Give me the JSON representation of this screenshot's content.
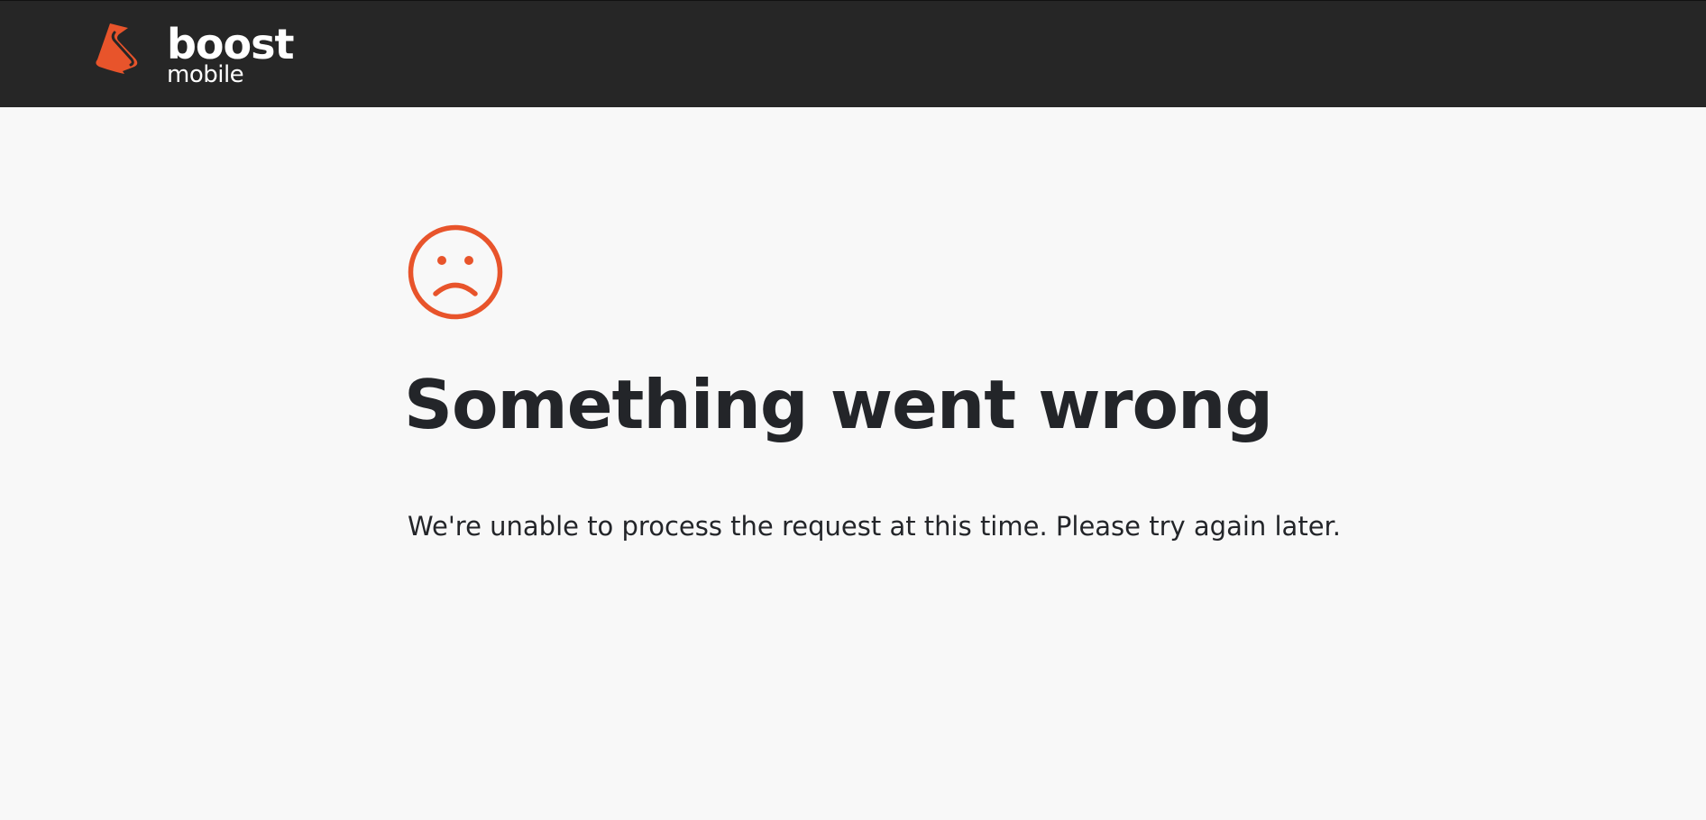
{
  "header": {
    "logo": {
      "wordmark": "boost",
      "sub": "mobile",
      "brand_color": "#e8542b",
      "text_color": "#ffffff"
    },
    "background": "#262626"
  },
  "error": {
    "icon": "sad-face-icon",
    "icon_color": "#e8542b",
    "title": "Something went wrong",
    "message": "We're unable to process the request at this time. Please try again later."
  },
  "colors": {
    "page_background": "#f8f8f8",
    "text": "#232529"
  }
}
